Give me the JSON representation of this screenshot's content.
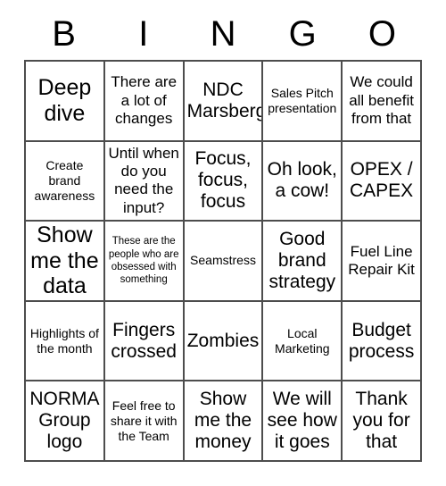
{
  "card": {
    "title": "BINGO",
    "header_letters": [
      "B",
      "I",
      "N",
      "G",
      "O"
    ],
    "grid_size": "5x5",
    "colors": {
      "border": "#4d4d4d",
      "text": "#000000",
      "background": "#ffffff"
    }
  },
  "rows": [
    {
      "cells": [
        {
          "text": "Deep dive",
          "size": "xl"
        },
        {
          "text": "There are a lot of changes",
          "size": "md"
        },
        {
          "text": "NDC Marsberg",
          "size": "lg"
        },
        {
          "text": "Sales Pitch presentation",
          "size": "sm"
        },
        {
          "text": "We could all benefit from that",
          "size": "md"
        }
      ]
    },
    {
      "cells": [
        {
          "text": "Create brand awareness",
          "size": "sm"
        },
        {
          "text": "Until when do you need the input?",
          "size": "md"
        },
        {
          "text": "Focus, focus, focus",
          "size": "lg"
        },
        {
          "text": "Oh look, a cow!",
          "size": "lg"
        },
        {
          "text": "OPEX / CAPEX",
          "size": "lg"
        }
      ]
    },
    {
      "cells": [
        {
          "text": "Show me the data",
          "size": "xl"
        },
        {
          "text": "These are the people who are obsessed with something",
          "size": "xs"
        },
        {
          "text": "Seamstress",
          "size": "sm"
        },
        {
          "text": "Good brand strategy",
          "size": "lg"
        },
        {
          "text": "Fuel Line Repair Kit",
          "size": "md"
        }
      ]
    },
    {
      "cells": [
        {
          "text": "Highlights of the month",
          "size": "sm"
        },
        {
          "text": "Fingers crossed",
          "size": "lg"
        },
        {
          "text": "Zombies",
          "size": "lg"
        },
        {
          "text": "Local Marketing",
          "size": "sm"
        },
        {
          "text": "Budget process",
          "size": "lg"
        }
      ]
    },
    {
      "cells": [
        {
          "text": "NORMA Group logo",
          "size": "lg"
        },
        {
          "text": "Feel free to share it with the Team",
          "size": "sm"
        },
        {
          "text": "Show me the money",
          "size": "lg"
        },
        {
          "text": "We will see how it goes",
          "size": "lg"
        },
        {
          "text": "Thank you for that",
          "size": "lg"
        }
      ]
    }
  ]
}
